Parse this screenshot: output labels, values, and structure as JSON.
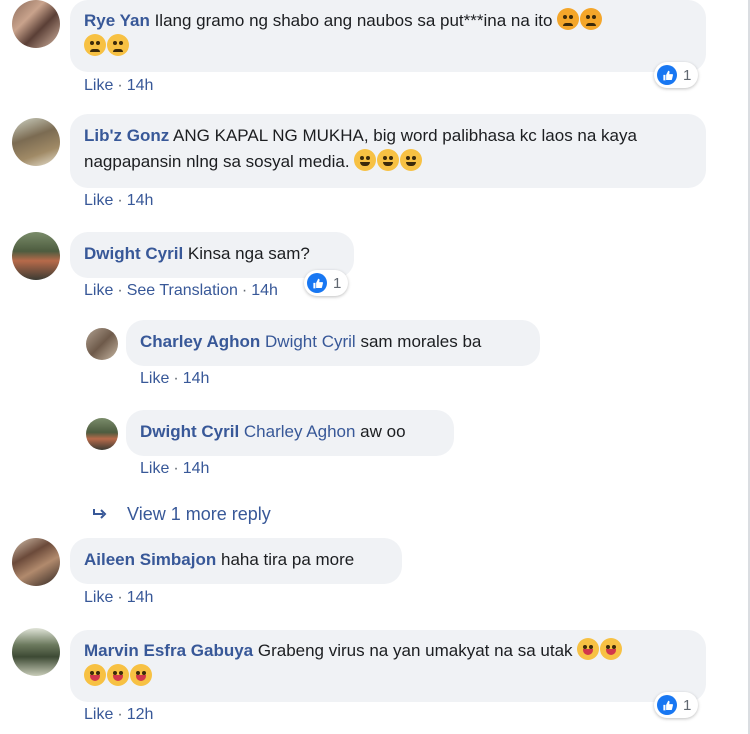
{
  "comments": [
    {
      "author": "Rye Yan",
      "text": "Ilang gramo ng shabo ang naubos sa put***ina na ito",
      "like": "Like",
      "time": "14h",
      "reaction_count": "1"
    },
    {
      "author": "Lib'z Gonz",
      "text": "ANG KAPAL NG MUKHA, big word palibhasa kc laos na kaya nagpapansin nlng sa sosyal media.",
      "like": "Like",
      "time": "14h"
    },
    {
      "author": "Dwight Cyril",
      "text": "Kinsa nga sam?",
      "like": "Like",
      "translate": "See Translation",
      "time": "14h",
      "reaction_count": "1",
      "replies": [
        {
          "author": "Charley Aghon",
          "tag": "Dwight Cyril",
          "text": "sam morales ba",
          "like": "Like",
          "time": "14h"
        },
        {
          "author": "Dwight Cyril",
          "tag": "Charley Aghon",
          "text": "aw oo",
          "like": "Like",
          "time": "14h"
        }
      ],
      "view_more": "View 1 more reply"
    },
    {
      "author": "Aileen Simbajon",
      "text": "haha tira pa more",
      "like": "Like",
      "time": "14h"
    },
    {
      "author": "Marvin Esfra Gabuya",
      "text": "Grabeng virus na yan umakyat na sa utak",
      "like": "Like",
      "time": "12h",
      "reaction_count": "1"
    }
  ],
  "colors": {
    "author": "#385898",
    "bubble": "#f0f2f5",
    "like_blue": "#1877f2"
  },
  "icons": {
    "reaction": "thumbs-up-icon",
    "reply_arrow": "reply-arrow-icon",
    "emoji_angry": "angry-face-icon",
    "emoji_steam": "face-with-steam-icon",
    "emoji_laugh": "tears-of-joy-icon",
    "emoji_tongue": "tongue-out-face-icon"
  }
}
